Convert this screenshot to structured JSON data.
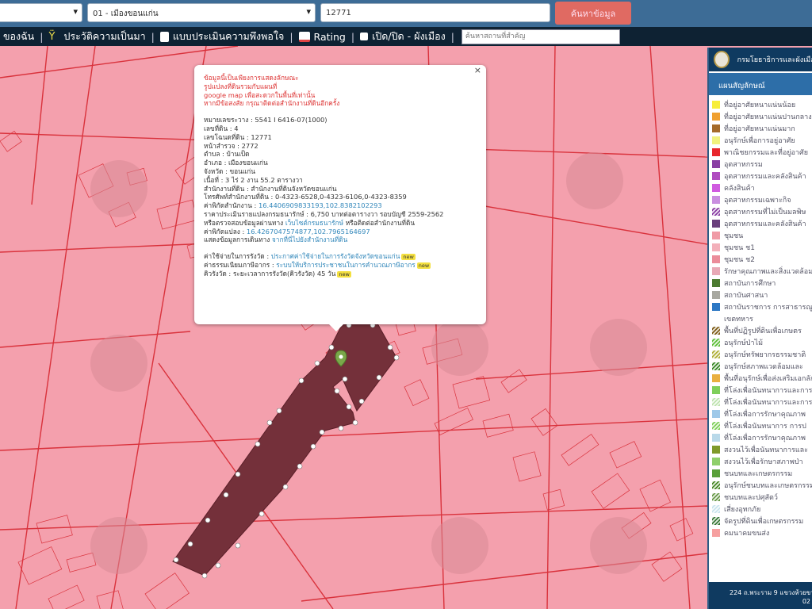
{
  "search": {
    "province_value": "",
    "district_value": "01 - เมืองขอนแก่น",
    "deed_value": "12771",
    "button_label": "ค้นหาข้อมูล"
  },
  "menu": {
    "item1": "ของฉัน",
    "item2": "ประวัติความเป็นมา",
    "item3": "แบบประเมินความพึงพอใจ",
    "item4": "Rating",
    "item5": "เปิด/ปิด - ผังเมือง",
    "search_placeholder": "ค้นหาสถานที่สำคัญ"
  },
  "popup": {
    "warning_lines": [
      "ข้อมูลนี้เป็นเพียงการแสดงลักษณะ",
      "รูปแปลงที่ดินรวมกับแผนที่",
      "google map เพื่อสะดวกในพื้นที่เท่านั้น",
      "หากมีข้อสงสัย กรุณาติดต่อสำนักงานที่ดินอีกครั้ง"
    ],
    "parcel_no": "หมายเลขระวาง : 5541 I 6416-07(1000)",
    "land_no": "เลขที่ดิน : 4",
    "deed_no": "เลขโฉนดที่ดิน : 12771",
    "survey_page": "หน้าสำรวจ : 2772",
    "subdistrict": "ตำบล : บ้านเป็ด",
    "district": "อำเภอ : เมืองขอนแก่น",
    "province": "จังหวัด : ขอนแก่น",
    "area": "เนื้อที่ : 3 ไร่ 2 งาน 55.2 ตารางวา",
    "office": "สำนักงานที่ดิน : สำนักงานที่ดินจังหวัดขอนแก่น",
    "office_phone": "โทรศัพท์สำนักงานที่ดิน : 0-4323-6528,0-4323-6106,0-4323-8359",
    "office_coords_label": "ค่าพิกัดสำนักงาน :",
    "office_coords": "16.4406909833193,102.8382102293",
    "price": "ราคาประเมินรายแปลงกรมธนารักษ์ : 6,750 บาทต่อตารางวา รอบบัญชี 2559-2562",
    "check_prefix": "หรือตรวจสอบข้อมูลผ่านทาง",
    "check_link": "เว็บไซต์กรมธนารักษ์",
    "check_suffix": "หรือติดต่อสำนักงานที่ดิน",
    "parcel_coords_label": "ค่าพิกัดแปลง :",
    "parcel_coords": "16.4267047574877,102.7965164697",
    "route_label": "แสดงข้อมูลการเดินทาง",
    "route_link": "จากที่นี่ไปยังสำนักงานที่ดิน",
    "fee_label": "ค่าใช้จ่ายในการรังวัด :",
    "fee_link": "ประกาศค่าใช้จ่ายในการรังวัดจังหวัดขอนแก่น",
    "tax_label": "ค่าธรรมเนียมภาษีอากร :",
    "tax_link": "ระบบให้บริการประชาชนในการคำนวณภาษีอากร",
    "queue_text": "คิวรังวัด : ระยะเวลาการรังวัด(คิวรังวัด) 45 วัน",
    "new_badge": "new"
  },
  "legend": {
    "header_title": "กรมโยธาธิการและผังเมือง",
    "subtitle": "แผนสัญลักษณ์",
    "footer": "224 ถ.พระราม 9 แขวงห้วยขวาง",
    "footer2": "02",
    "items": [
      {
        "label": "ที่อยู่อาศัยหนาแน่นน้อย",
        "color": "#f7ee3a"
      },
      {
        "label": "ที่อยู่อาศัยหนาแน่นปานกลาง",
        "color": "#f0a030"
      },
      {
        "label": "ที่อยู่อาศัยหนาแน่นมาก",
        "color": "#a56b2a"
      },
      {
        "label": "อนุรักษ์เพื่อการอยู่อาศัย",
        "color": "#f1f27e"
      },
      {
        "label": "พาณิชยกรรมและที่อยู่อาศัย",
        "color": "#e8262c"
      },
      {
        "label": "อุตสาหกรรม",
        "color": "#8a3fa4"
      },
      {
        "label": "อุตสาหกรรมและคลังสินค้า",
        "color": "#b04cc0"
      },
      {
        "label": "คลังสินค้า",
        "color": "#d05be0"
      },
      {
        "label": "อุตสาหกรรมเฉพาะกิจ",
        "color": "#c98ee0"
      },
      {
        "label": "อุตสาหกรรมที่ไม่เป็นมลพิษ",
        "color": "#8a3fa4",
        "hatch": true
      },
      {
        "label": "อุตสาหกรรมและคลังสินค้า",
        "color": "#6a3e7c"
      },
      {
        "label": "ชุมชน",
        "color": "#f09aa6"
      },
      {
        "label": "ชุมชน ช1",
        "color": "#f3b0ba"
      },
      {
        "label": "ชุมชน ช2",
        "color": "#eb8c9a"
      },
      {
        "label": "รักษาคุณภาพและสิ่งแวดล้อม",
        "color": "#e8a9b6"
      },
      {
        "label": "สถาบันการศึกษา",
        "color": "#4c7b30"
      },
      {
        "label": "สถาบันศาสนา",
        "color": "#a8a8a0"
      },
      {
        "label": "สถาบันราชการ การสาธารณูปโภค",
        "color": "#2d78c4"
      },
      {
        "label": "เขตทหาร",
        "color": "#ffffff"
      },
      {
        "label": "พื้นที่ปฏิรูปที่ดินเพื่อเกษตร",
        "color": "#7f5e1a",
        "hatch": true
      },
      {
        "label": "อนุรักษ์ป่าไม้",
        "color": "#5fbf3a",
        "hatch": true
      },
      {
        "label": "อนุรักษ์ทรัพยากรธรรมชาติ",
        "color": "#b0b03a",
        "hatch": true
      },
      {
        "label": "อนุรักษ์สภาพแวดล้อมและ",
        "color": "#3c8a2a",
        "hatch": true
      },
      {
        "label": "พื้นที่อนุรักษ์เพื่อส่งเสริมเอกลักษณ์",
        "color": "#e9b040"
      },
      {
        "label": "ที่โล่งเพื่อนันทนาการและการ",
        "color": "#7fcf5a"
      },
      {
        "label": "ที่โล่งเพื่อนันทนาการและการ",
        "color": "#bfe3b0",
        "hatch": true
      },
      {
        "label": "ที่โล่งเพื่อการรักษาคุณภาพ",
        "color": "#9fc9e9"
      },
      {
        "label": "ที่โล่งเพื่อนันทนาการ การป",
        "color": "#7fcf5a",
        "hatch": true
      },
      {
        "label": "ที่โล่งเพื่อการรักษาคุณภาพ",
        "color": "#b9d9e9"
      },
      {
        "label": "สงวนไว้เพื่อนันทนาการและ",
        "color": "#7f9a2a"
      },
      {
        "label": "สงวนไว้เพื่อรักษาสภาพป่า",
        "color": "#8fcf6a"
      },
      {
        "label": "ชนบทและเกษตรกรรม",
        "color": "#5aa03a"
      },
      {
        "label": "อนุรักษ์ชนบทและเกษตรกรรม",
        "color": "#4a8a2a",
        "hatch": true
      },
      {
        "label": "ชนบทและปศุสัตว์",
        "color": "#6a9a4a",
        "hatch": true
      },
      {
        "label": "เสี่ยงอุทกภัย",
        "color": "#c9e4ee",
        "hatch": true
      },
      {
        "label": "จัดรูปที่ดินเพื่อเกษตรกรรม",
        "color": "#3a7a3a",
        "hatch": true
      },
      {
        "label": "คมนาคมขนส่ง",
        "color": "#f6a0a0"
      }
    ]
  }
}
